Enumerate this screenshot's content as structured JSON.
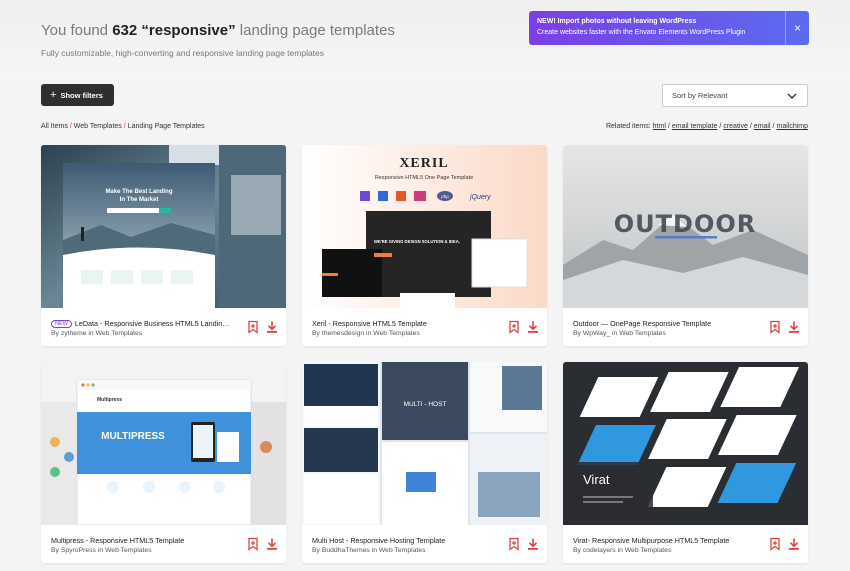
{
  "header": {
    "headline_prefix": "You found",
    "result_count": "632",
    "query": "“responsive”",
    "headline_suffix": "landing page templates",
    "subheading": "Fully customizable, high-converting and responsive landing page templates"
  },
  "promo": {
    "line1": "NEW! Import photos without leaving WordPress",
    "line2": "Create websites faster with the Envato Elements WordPress Plugin",
    "close_icon": "×"
  },
  "toolbar": {
    "filters_label": "Show filters",
    "sort_label": "Sort by Relevant"
  },
  "breadcrumb": {
    "items": [
      "All Items",
      "Web Templates",
      "Landing Page Templates"
    ],
    "separator": "/"
  },
  "related": {
    "label": "Related items:",
    "items": [
      "html",
      "email template",
      "creative",
      "email",
      "mailchimp"
    ]
  },
  "cards": [
    {
      "title": "LeData - Responsive Business HTML5 Landing ...",
      "author": "By zytheme in Web Templates",
      "badge": "NEW",
      "thumb_lines": [
        "Make The Best Landing",
        "In The Market"
      ]
    },
    {
      "title": "Xeril - Responsive HTML5 Template",
      "author": "By themesdesign in Web Templates",
      "thumb_title": "XERIL",
      "thumb_sub": "Responsive HTML5 One Page Template",
      "thumb_text": "WE'RE GIVING DESIGN SOLUTION & IDEA.",
      "thumb_tech": [
        "jQuery",
        "php"
      ]
    },
    {
      "title": "Outdoor — OnePage Responsive Template",
      "author": "By WpWay_ in Web Templates",
      "thumb_title": "OUTDOOR"
    },
    {
      "title": "Multipress - Responsive HTML5 Template",
      "author": "By SpyroPress in Web Templates",
      "thumb_title": "MULTIPRESS",
      "thumb_brand": "Multipress"
    },
    {
      "title": "Multi Host - Responsive Hosting Template",
      "author": "By BuddhaThemes in Web Templates",
      "thumb_title": "MULTI - HOST"
    },
    {
      "title": "Virat- Responsive Multipurpose HTML5 Template",
      "author": "By codelayers in Web Templates",
      "thumb_title": "Virat"
    }
  ],
  "icons": {
    "bookmark": "bookmark-icon",
    "download": "download-icon"
  },
  "colors": {
    "accent": "#e0403d",
    "promo_start": "#7b3fe4",
    "promo_end": "#5b6bf0",
    "button_dark": "#2f2f2f"
  }
}
